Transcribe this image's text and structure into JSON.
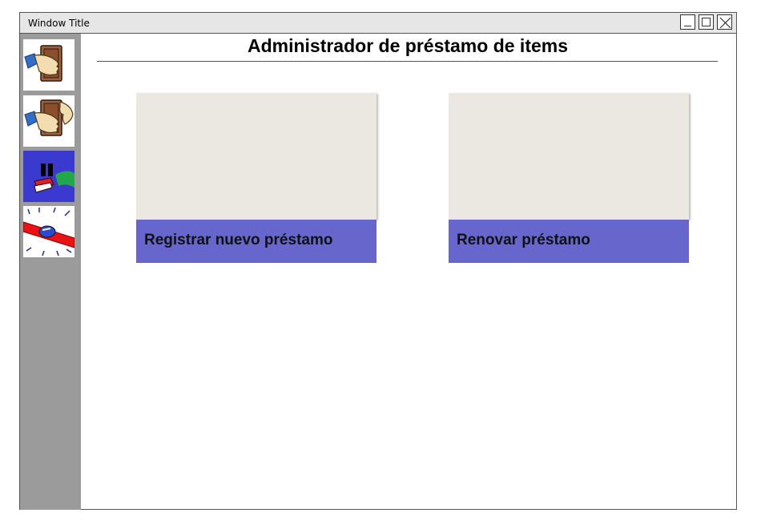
{
  "window": {
    "title": "Window Title"
  },
  "sidebar": {
    "items": [
      {
        "icon": "hand-giving-book-icon"
      },
      {
        "icon": "hands-exchanging-book-icon"
      },
      {
        "icon": "paused-book-return-icon"
      },
      {
        "icon": "siren-alert-icon"
      }
    ]
  },
  "main": {
    "heading": "Administrador de préstamo de items",
    "cards": [
      {
        "label": "Registrar nuevo préstamo"
      },
      {
        "label": "Renovar préstamo"
      }
    ]
  },
  "colors": {
    "sidebar": "#9b9b9b",
    "card_label_bg": "#6666cc",
    "card_image_bg": "#ebe8e1"
  }
}
